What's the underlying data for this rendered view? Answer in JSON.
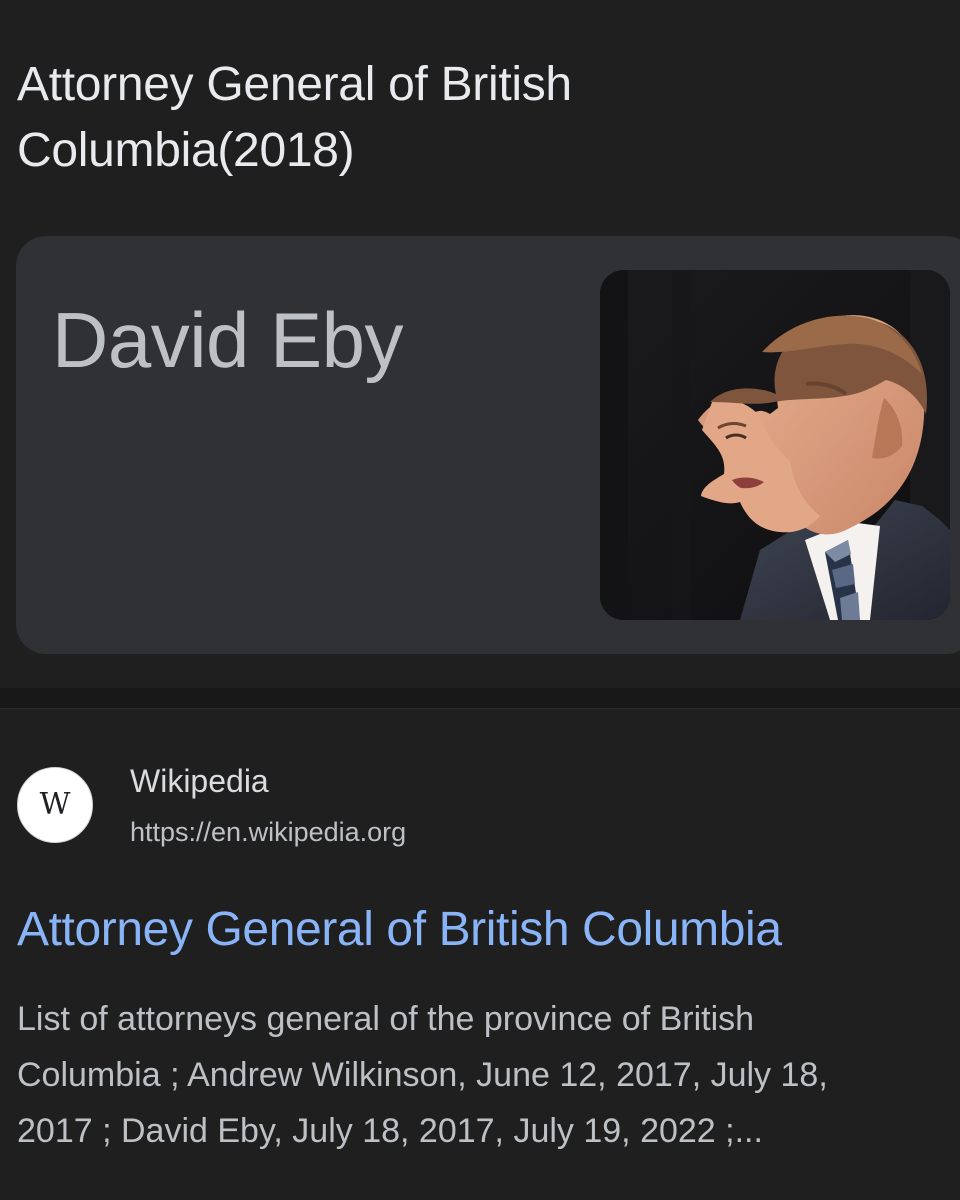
{
  "page": {
    "title_line_1": "Attorney General of British",
    "title_line_2": "Columbia(2018)"
  },
  "answer_card": {
    "name": "David Eby"
  },
  "result": {
    "favicon_letter": "W",
    "site_name": "Wikipedia",
    "url": "https://en.wikipedia.org",
    "title": "Attorney General of British Columbia",
    "snippet_lines": [
      "List of attorneys general of the province of British",
      "Columbia ; Andrew Wilkinson, June 12, 2017, July 18,",
      "2017 ; David Eby, July 18, 2017, July 19, 2022 ;..."
    ]
  },
  "colors": {
    "background": "#1f1f1f",
    "card": "#303134",
    "link": "#8ab4f8",
    "text_primary": "#e8eaed",
    "text_secondary": "#bdc1c6"
  },
  "icons": {
    "favicon": "wikipedia-logo-icon"
  }
}
